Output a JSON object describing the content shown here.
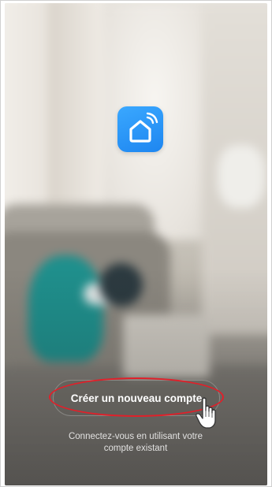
{
  "app": {
    "logo_icon": "smart-home-wifi-icon",
    "logo_color": "#2a95f7"
  },
  "actions": {
    "create_account_label": "Créer un nouveau compte",
    "login_line1": "Connectez-vous en utilisant votre",
    "login_line2": "compte existant"
  },
  "annotation": {
    "highlight_color": "#e0202a",
    "cursor_icon": "hand-pointer-icon"
  }
}
